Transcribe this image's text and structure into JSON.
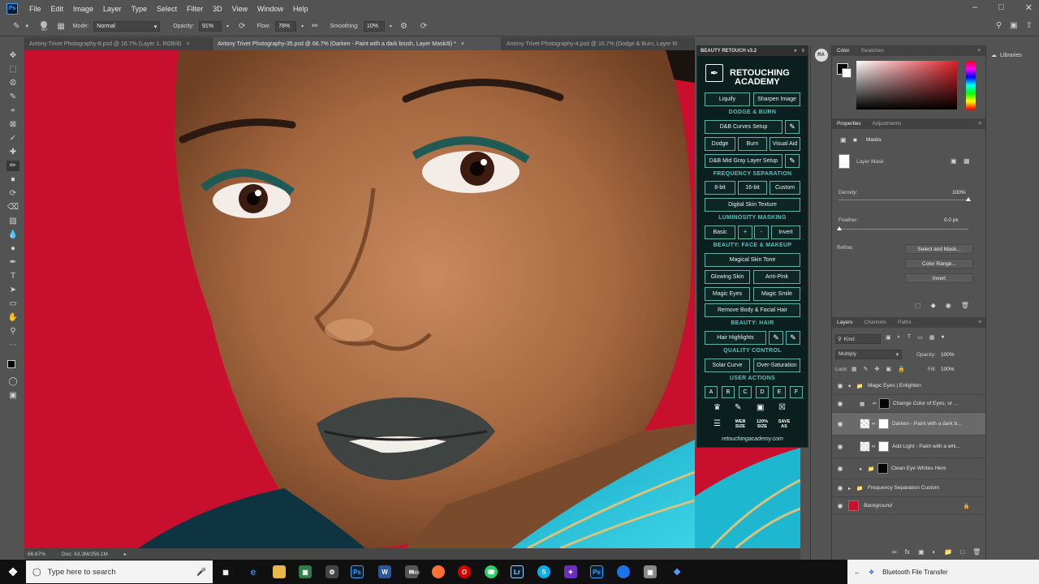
{
  "menubar": {
    "logo": "Ps",
    "items": [
      "File",
      "Edit",
      "Image",
      "Layer",
      "Type",
      "Select",
      "Filter",
      "3D",
      "View",
      "Window",
      "Help"
    ]
  },
  "optbar": {
    "brush_size": "80",
    "mode_label": "Mode:",
    "mode_value": "Normal",
    "opacity_label": "Opacity:",
    "opacity_value": "91%",
    "flow_label": "Flow:",
    "flow_value": "78%",
    "smoothing_label": "Smoothing:",
    "smoothing_value": "10%"
  },
  "tabs": [
    {
      "label": "Antony Trivet Photography-8.psd @ 16.7% (Layer 1, RGB/8)",
      "close": "×"
    },
    {
      "label": "Antony Trivet Photography-35.psd @ 66.7% (Darken - Paint with a dark brush, Layer Mask/8) *",
      "close": "×"
    },
    {
      "label": "Antony Trivet Photography-4.psd @ 16.7% (Dodge & Burn, Layer M",
      "close": ""
    }
  ],
  "status": {
    "zoom": "66.67%",
    "doc": "Doc: 63.3M/256.1M"
  },
  "retouch": {
    "header": "BEAUTY RETOUCH v3.2",
    "brand_top": "RETOUCHING",
    "brand_bottom": "ACADEMY",
    "liquify": "Liquify",
    "sharpen": "Sharpen Image",
    "sec_dodge": "DODGE & BURN",
    "db_curves": "D&B Curves Setup",
    "dodge": "Dodge",
    "burn": "Burn",
    "visual_aid": "Visual Aid",
    "db_midgray": "D&B Mid Gray Layer Setup",
    "sec_freq": "FREQUENCY SEPARATION",
    "bit8": "8-bit",
    "bit16": "16-bit",
    "custom": "Custom",
    "digital_skin": "Digital Skin Texture",
    "sec_lum": "LUMINOSITY MASKING",
    "basic": "Basic",
    "plus": "+",
    "minus": "-",
    "invert": "Invert",
    "sec_face": "BEAUTY: FACE & MAKEUP",
    "magical_skin": "Magical Skin Tone",
    "glowing_skin": "Glowing Skin",
    "anti_pink": "Anti-Pink",
    "magic_eyes": "Magic Eyes",
    "magic_smile": "Magic Smile",
    "remove_hair": "Remove Body & Facial Hair",
    "sec_hair": "BEAUTY: HAIR",
    "hair_highlights": "Hair Highlights",
    "sec_quality": "QUALITY CONTROL",
    "solar_curve": "Solar Curve",
    "over_saturation": "Over-Saturation",
    "sec_user": "USER ACTIONS",
    "actions": [
      "A",
      "B",
      "C",
      "D",
      "E",
      "F"
    ],
    "web_size": "WEB SIZE",
    "size_120": "120% SIZE",
    "save_as": "SAVE AS",
    "url": "retouchingacademy.com"
  },
  "color_panel": {
    "tabs": [
      "Color",
      "Swatches"
    ]
  },
  "properties": {
    "tabs": [
      "Properties",
      "Adjustments"
    ],
    "masks_label": "Masks",
    "layer_mask": "Layer Mask",
    "density_label": "Density:",
    "density_value": "100%",
    "feather_label": "Feather:",
    "feather_value": "0.0 px",
    "refine_label": "Refine:",
    "select_mask": "Select and Mask...",
    "color_range": "Color Range...",
    "invert": "Invert"
  },
  "layers": {
    "tabs": [
      "Layers",
      "Channels",
      "Paths"
    ],
    "kind": "Kind",
    "blend": "Multiply",
    "opacity_label": "Opacity:",
    "opacity_value": "100%",
    "lock_label": "Lock:",
    "fill_label": "Fill:",
    "fill_value": "100%",
    "items": [
      {
        "name": "Magic Eyes | Enlighten"
      },
      {
        "name": "Change Color of Eyes, or ..."
      },
      {
        "name": "Darken - Paint with a dark b..."
      },
      {
        "name": "Add Light - Paint with a whi..."
      },
      {
        "name": "Clean Eye Whites Here"
      },
      {
        "name": "Frequency Separation Custom"
      },
      {
        "name": "Background"
      }
    ]
  },
  "libraries": {
    "label": "Libraries"
  },
  "taskbar": {
    "search_placeholder": "Type here to search",
    "mail_badge": "49",
    "toast": "Bluetooth File Transfer"
  },
  "colors": {
    "backdrop_red": "#c8102e",
    "panel_teal": "#48c7bd",
    "ps_blue": "#31a8ff"
  }
}
